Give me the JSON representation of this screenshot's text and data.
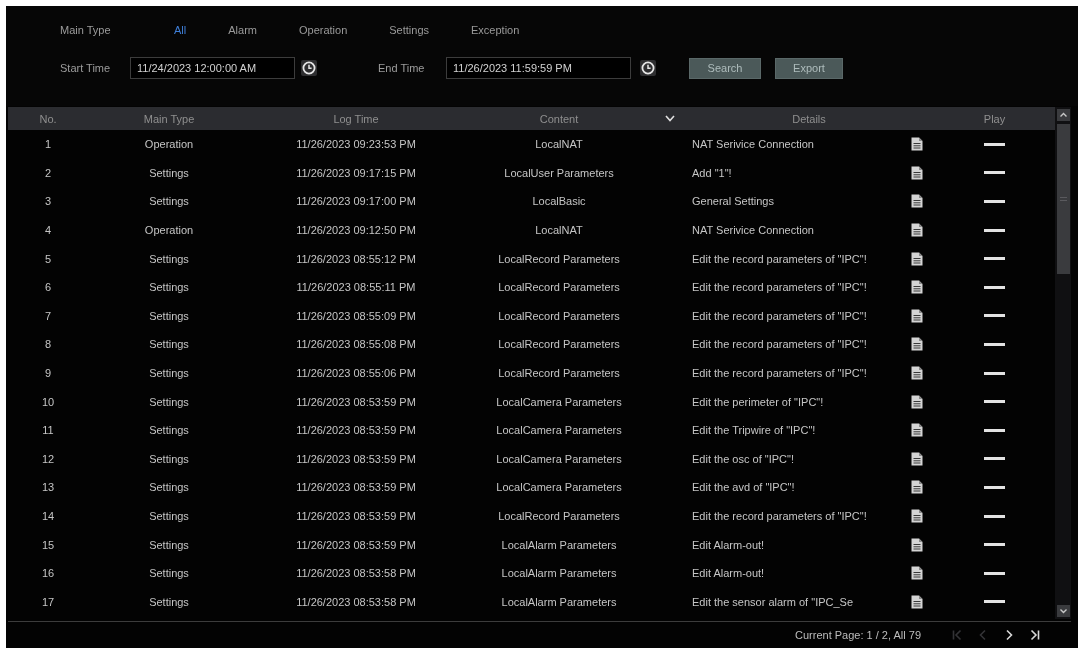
{
  "filter": {
    "main_type_label": "Main Type",
    "main_types": [
      {
        "label": "All",
        "selected": true
      },
      {
        "label": "Alarm",
        "selected": false
      },
      {
        "label": "Operation",
        "selected": false
      },
      {
        "label": "Settings",
        "selected": false
      },
      {
        "label": "Exception",
        "selected": false
      }
    ],
    "start_time": {
      "label": "Start Time",
      "value": "11/24/2023 12:00:00 AM"
    },
    "end_time": {
      "label": "End Time",
      "value": "11/26/2023 11:59:59 PM"
    },
    "buttons": [
      "Search",
      "Export"
    ]
  },
  "table": {
    "columns": [
      "No.",
      "Main Type",
      "Log Time",
      "Content",
      "Details",
      "Play"
    ],
    "rows": [
      {
        "no": "1",
        "main_type": "Operation",
        "log_time": "11/26/2023 09:23:53 PM",
        "content": "LocalNAT",
        "details": "NAT Serivice Connection"
      },
      {
        "no": "2",
        "main_type": "Settings",
        "log_time": "11/26/2023 09:17:15 PM",
        "content": "LocalUser Parameters",
        "details": "Add \"1\"!"
      },
      {
        "no": "3",
        "main_type": "Settings",
        "log_time": "11/26/2023 09:17:00 PM",
        "content": "LocalBasic",
        "details": "General Settings"
      },
      {
        "no": "4",
        "main_type": "Operation",
        "log_time": "11/26/2023 09:12:50 PM",
        "content": "LocalNAT",
        "details": "NAT Serivice Connection"
      },
      {
        "no": "5",
        "main_type": "Settings",
        "log_time": "11/26/2023 08:55:12 PM",
        "content": "LocalRecord Parameters",
        "details": "Edit the record parameters of \"IPC\"!"
      },
      {
        "no": "6",
        "main_type": "Settings",
        "log_time": "11/26/2023 08:55:11 PM",
        "content": "LocalRecord Parameters",
        "details": "Edit the record parameters of \"IPC\"!"
      },
      {
        "no": "7",
        "main_type": "Settings",
        "log_time": "11/26/2023 08:55:09 PM",
        "content": "LocalRecord Parameters",
        "details": "Edit the record parameters of \"IPC\"!"
      },
      {
        "no": "8",
        "main_type": "Settings",
        "log_time": "11/26/2023 08:55:08 PM",
        "content": "LocalRecord Parameters",
        "details": "Edit the record parameters of \"IPC\"!"
      },
      {
        "no": "9",
        "main_type": "Settings",
        "log_time": "11/26/2023 08:55:06 PM",
        "content": "LocalRecord Parameters",
        "details": "Edit the record parameters of \"IPC\"!"
      },
      {
        "no": "10",
        "main_type": "Settings",
        "log_time": "11/26/2023 08:53:59 PM",
        "content": "LocalCamera Parameters",
        "details": "Edit the perimeter of \"IPC\"!"
      },
      {
        "no": "11",
        "main_type": "Settings",
        "log_time": "11/26/2023 08:53:59 PM",
        "content": "LocalCamera Parameters",
        "details": "Edit the Tripwire of \"IPC\"!"
      },
      {
        "no": "12",
        "main_type": "Settings",
        "log_time": "11/26/2023 08:53:59 PM",
        "content": "LocalCamera Parameters",
        "details": "Edit the osc of \"IPC\"!"
      },
      {
        "no": "13",
        "main_type": "Settings",
        "log_time": "11/26/2023 08:53:59 PM",
        "content": "LocalCamera Parameters",
        "details": "Edit the avd of \"IPC\"!"
      },
      {
        "no": "14",
        "main_type": "Settings",
        "log_time": "11/26/2023 08:53:59 PM",
        "content": "LocalRecord Parameters",
        "details": "Edit the record parameters of \"IPC\"!"
      },
      {
        "no": "15",
        "main_type": "Settings",
        "log_time": "11/26/2023 08:53:59 PM",
        "content": "LocalAlarm Parameters",
        "details": "Edit Alarm-out!"
      },
      {
        "no": "16",
        "main_type": "Settings",
        "log_time": "11/26/2023 08:53:58 PM",
        "content": "LocalAlarm Parameters",
        "details": "Edit Alarm-out!"
      },
      {
        "no": "17",
        "main_type": "Settings",
        "log_time": "11/26/2023 08:53:58 PM",
        "content": "LocalAlarm Parameters",
        "details": "Edit the sensor alarm of \"IPC_Se"
      }
    ]
  },
  "pagination": {
    "summary": "Current Page: 1 / 2, All 79",
    "controls": [
      {
        "kind": "first",
        "disabled": true
      },
      {
        "kind": "prev",
        "disabled": true
      },
      {
        "kind": "next",
        "disabled": false
      },
      {
        "kind": "last",
        "disabled": false
      }
    ]
  }
}
